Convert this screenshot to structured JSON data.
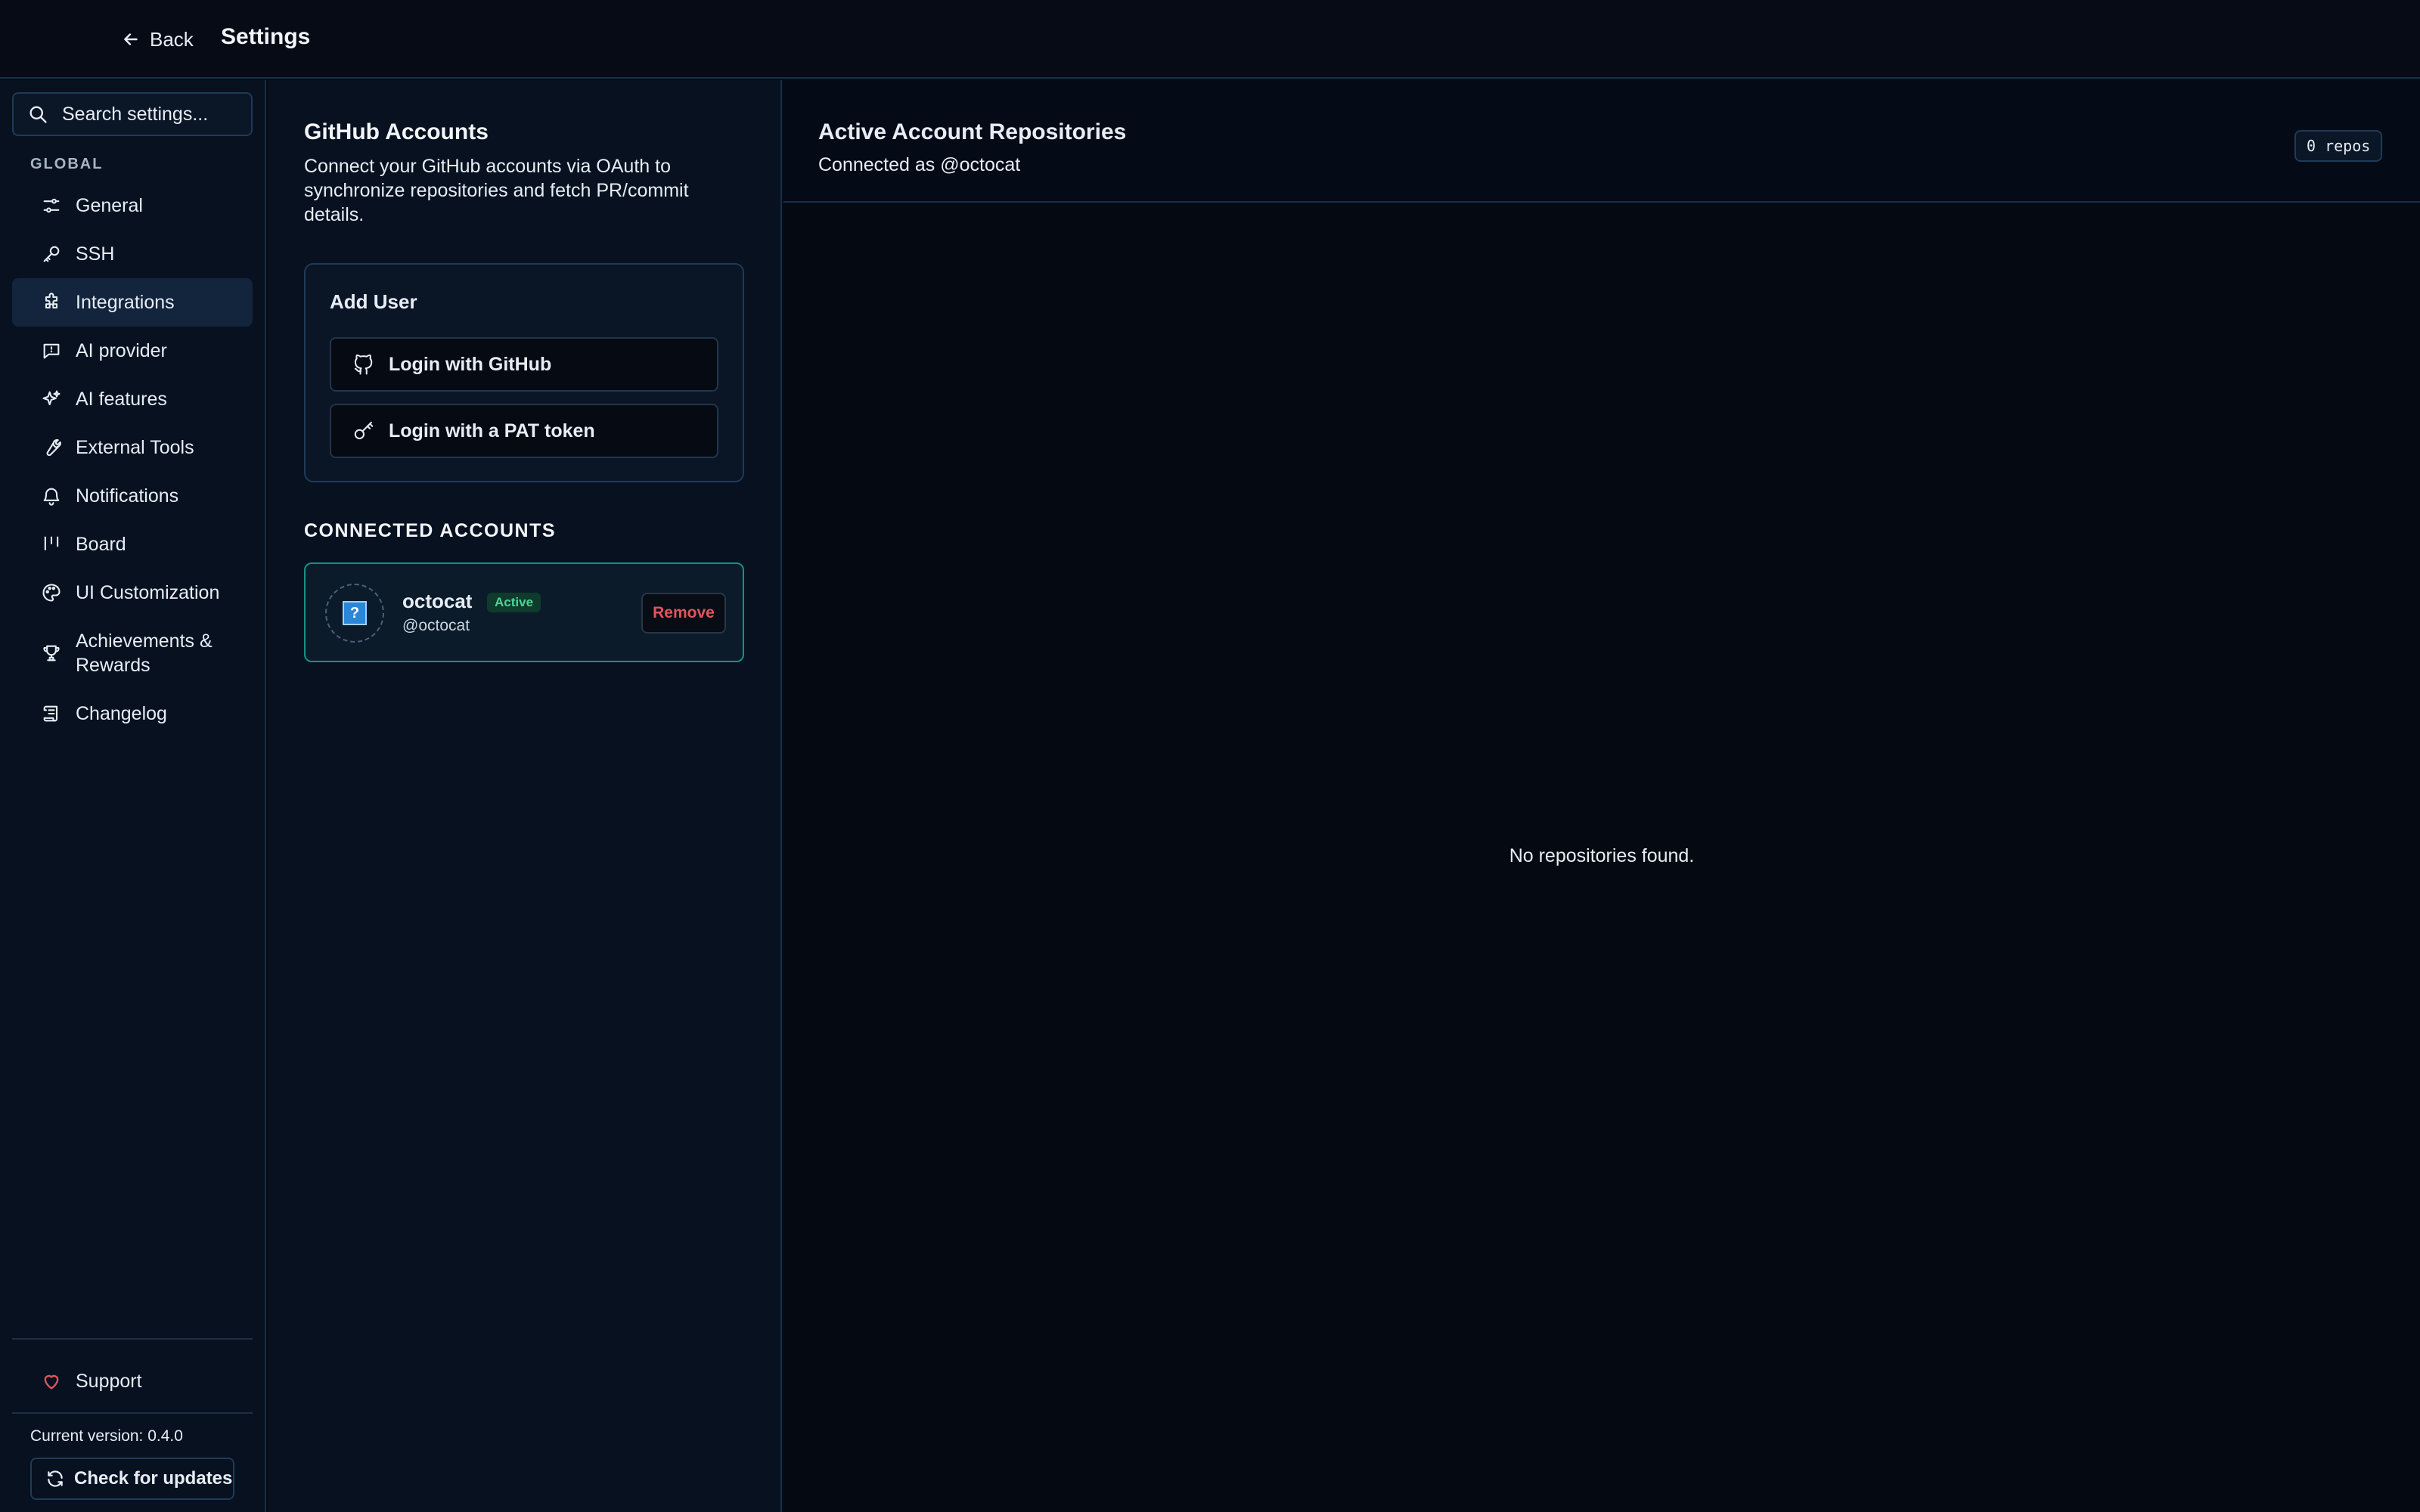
{
  "header": {
    "back_label": "Back",
    "title": "Settings"
  },
  "sidebar": {
    "search_placeholder": "Search settings...",
    "group_label": "GLOBAL",
    "items": [
      {
        "label": "General",
        "icon": "sliders-icon"
      },
      {
        "label": "SSH",
        "icon": "key-icon"
      },
      {
        "label": "Integrations",
        "icon": "puzzle-icon",
        "active": true
      },
      {
        "label": "AI provider",
        "icon": "message-icon"
      },
      {
        "label": "AI features",
        "icon": "sparkles-icon"
      },
      {
        "label": "External Tools",
        "icon": "wrench-icon"
      },
      {
        "label": "Notifications",
        "icon": "bell-icon"
      },
      {
        "label": "Board",
        "icon": "board-icon"
      },
      {
        "label": "UI Customization",
        "icon": "palette-icon"
      },
      {
        "label": "Achievements & Rewards",
        "icon": "trophy-icon"
      },
      {
        "label": "Changelog",
        "icon": "scroll-icon"
      }
    ],
    "support_label": "Support",
    "version_text": "Current version: 0.4.0",
    "update_label": "Check for updates"
  },
  "github": {
    "title": "GitHub Accounts",
    "description": "Connect your GitHub accounts via OAuth to synchronize repositories and fetch PR/commit details.",
    "add_user": {
      "title": "Add User",
      "login_github": "Login with GitHub",
      "login_pat": "Login with a PAT token"
    },
    "connected_label": "CONNECTED ACCOUNTS",
    "account": {
      "avatar_glyph": "?",
      "name": "octocat",
      "badge": "Active",
      "handle": "@octocat",
      "remove_label": "Remove"
    }
  },
  "repos": {
    "title": "Active Account Repositories",
    "subtitle": "Connected as @octocat",
    "count_badge": "0 repos",
    "empty_message": "No repositories found."
  },
  "colors": {
    "background": "#060b15",
    "panel": "#081120",
    "active_nav": "#13243d",
    "accent_teal": "#1a8f86",
    "active_badge": "#4fd39a",
    "danger": "#e2545c",
    "heart": "#e2545c"
  }
}
